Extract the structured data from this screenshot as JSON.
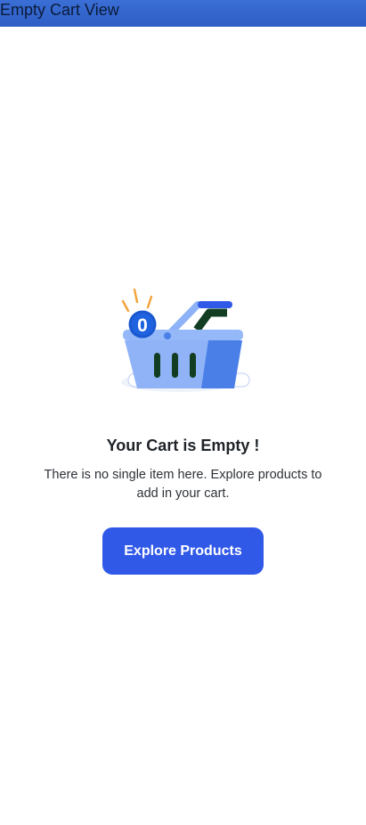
{
  "app_bar": {
    "title": "Empty Cart View",
    "color": "#2c5dc4"
  },
  "illustration": {
    "icon": "empty-basket-icon",
    "badge_count": "0",
    "accent_color": "#3159e8"
  },
  "empty_state": {
    "title": "Your Cart is Empty !",
    "description": "There is no single item here. Explore products to add in your cart."
  },
  "cta": {
    "label": "Explore Products",
    "color": "#3159e8"
  }
}
